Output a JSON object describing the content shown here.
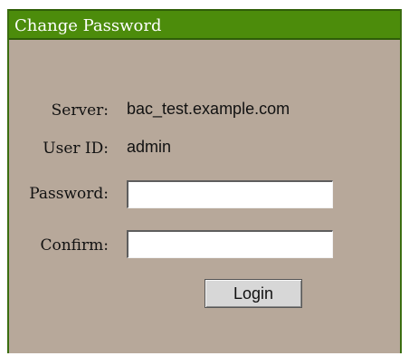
{
  "window": {
    "title": "Change Password"
  },
  "form": {
    "server_label": "Server:",
    "server_value": "bac_test.example.com",
    "userid_label": "User ID:",
    "userid_value": "admin",
    "password_label": "Password:",
    "password_value": "",
    "confirm_label": "Confirm:",
    "confirm_value": "",
    "login_label": "Login"
  },
  "colors": {
    "titlebar": "#4c8c0b",
    "panel_background": "#b7a89a",
    "title_text": "#ffffff"
  }
}
